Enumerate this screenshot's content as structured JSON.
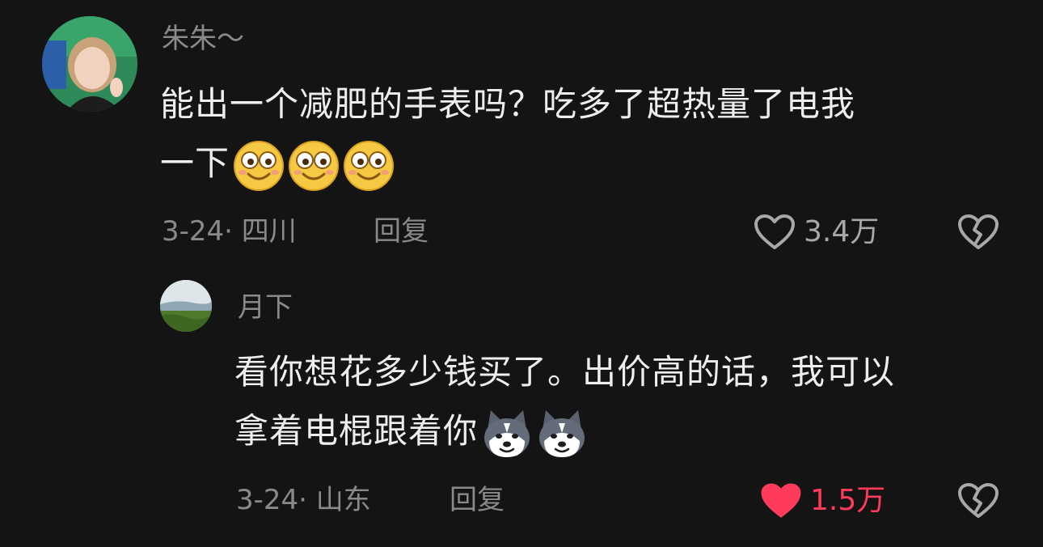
{
  "comments": [
    {
      "username": "朱朱～",
      "text_lines": [
        "能出一个减肥的手表吗？吃多了超热量了电我",
        "一下"
      ],
      "emoji_icons": [
        "smile-emoji-icon",
        "smile-emoji-icon",
        "smile-emoji-icon"
      ],
      "date_location": "3-24· 四川",
      "reply_label": "回复",
      "like_count": "3.4万",
      "liked": false
    },
    {
      "username": "月下",
      "text_lines": [
        "看你想花多少钱买了。出价高的话，我可以",
        "拿着电棍跟着你"
      ],
      "emoji_icons": [
        "husky-dog-emoji-icon",
        "husky-dog-emoji-icon"
      ],
      "date_location": "3-24· 山东",
      "reply_label": "回复",
      "like_count": "1.5万",
      "liked": true
    }
  ],
  "colors": {
    "background": "#141414",
    "text": "#eeeeee",
    "secondary_text": "#8a8a8a",
    "like_active": "#ff3b5c"
  }
}
